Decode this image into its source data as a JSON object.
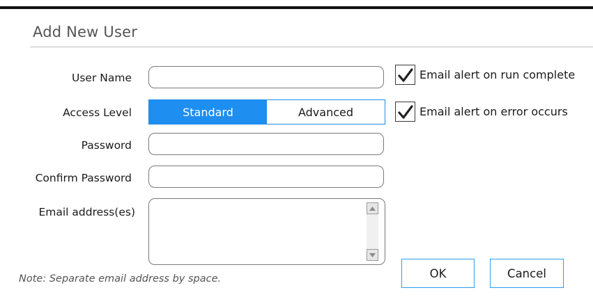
{
  "dialog": {
    "title": "Add New User"
  },
  "form": {
    "user_name_label": "User Name",
    "user_name_value": "",
    "access_level_label": "Access Level",
    "access_options": [
      "Standard",
      "Advanced"
    ],
    "access_selected": "Standard",
    "password_label": "Password",
    "password_value": "",
    "confirm_password_label": "Confirm Password",
    "confirm_password_value": "",
    "email_label": "Email address(es)",
    "email_value": ""
  },
  "options": {
    "alert_run_complete_label": "Email alert on run complete",
    "alert_run_complete_checked": true,
    "alert_error_label": "Email alert on error occurs",
    "alert_error_checked": true
  },
  "note": "Note: Separate email address by space.",
  "buttons": {
    "ok": "OK",
    "cancel": "Cancel"
  },
  "colors": {
    "accent": "#1e8ef0",
    "button_border": "#2a9df4"
  }
}
